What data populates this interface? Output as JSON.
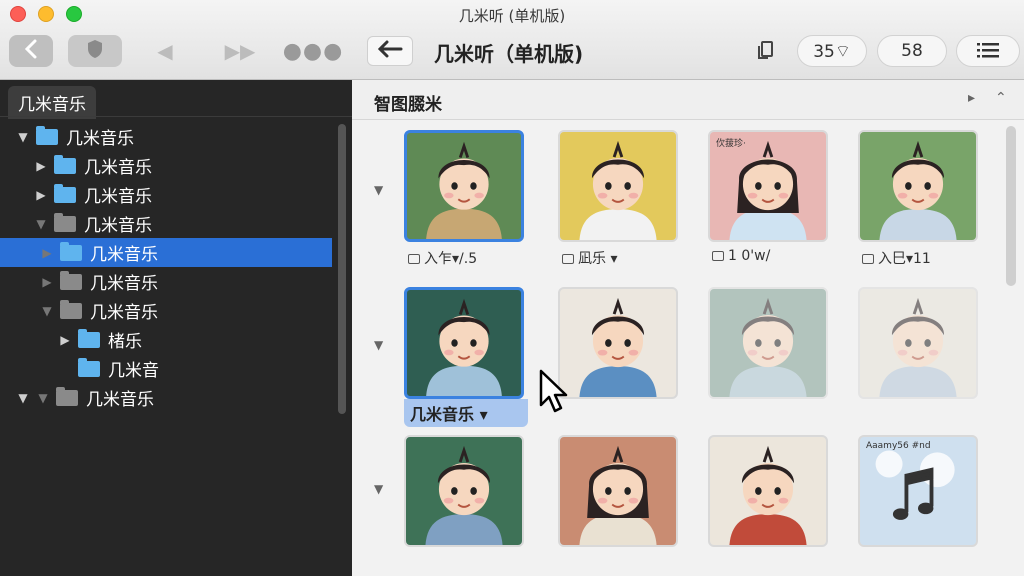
{
  "window": {
    "title": "几米听 (单机版)"
  },
  "toolbar": {
    "main_title": "几米听（单机版)",
    "pill_left": "35⌔",
    "pill_right": "58"
  },
  "sidebar": {
    "tab_label": "几米音乐",
    "items": [
      {
        "label": "几米音乐",
        "depth": 0,
        "state": "expanded",
        "color": "blue",
        "selected": false
      },
      {
        "label": "几米音乐",
        "depth": 1,
        "state": "collapsed",
        "color": "blue",
        "selected": false
      },
      {
        "label": "几米音乐",
        "depth": 1,
        "state": "collapsed",
        "color": "blue",
        "selected": false
      },
      {
        "label": "几米音乐",
        "depth": 1,
        "state": "expanded-dim",
        "color": "gray",
        "selected": false
      },
      {
        "label": "几米音乐",
        "depth": 2,
        "state": "collapsed-dim",
        "color": "blue",
        "selected": true
      },
      {
        "label": "几米音乐",
        "depth": 2,
        "state": "collapsed-dim",
        "color": "gray",
        "selected": false
      },
      {
        "label": "几米音乐",
        "depth": 2,
        "state": "expanded-dim",
        "color": "gray",
        "selected": false
      },
      {
        "label": "楮乐",
        "depth": 3,
        "state": "collapsed",
        "color": "blue",
        "selected": false
      },
      {
        "label": "几米音",
        "depth": 3,
        "state": "none",
        "color": "blue",
        "selected": false
      },
      {
        "label": "几米音乐",
        "depth": 0,
        "state": "expanded-dim2",
        "color": "gray",
        "selected": false
      }
    ]
  },
  "content": {
    "section_title": "智图腏米",
    "tiles": [
      {
        "caption": "入乍▾/.5",
        "row": 0,
        "col": 0,
        "selected": true,
        "bg": "#5f8a55",
        "art_text": ""
      },
      {
        "caption": "凪乐 ▾",
        "row": 0,
        "col": 1,
        "selected": false,
        "bg": "#e3c95c",
        "art_text": ""
      },
      {
        "caption": "1 0'w/",
        "row": 0,
        "col": 2,
        "selected": false,
        "bg": "#e8b7b4",
        "art_text": "㐸菝珍·"
      },
      {
        "caption": "入巳▾11",
        "row": 0,
        "col": 3,
        "selected": false,
        "bg": "#79a469",
        "art_text": ""
      },
      {
        "caption": "几米音乐 ▾",
        "row": 1,
        "col": 0,
        "selected": true,
        "bg": "#2f5e52",
        "art_text": ""
      },
      {
        "caption": "",
        "row": 1,
        "col": 1,
        "selected": false,
        "bg": "#ece7df",
        "art_text": ""
      },
      {
        "caption": "",
        "row": 1,
        "col": 2,
        "selected": false,
        "bg": "#7f9f92",
        "art_text": "",
        "faded": true
      },
      {
        "caption": "",
        "row": 1,
        "col": 3,
        "selected": false,
        "bg": "#e6e2d8",
        "art_text": "",
        "faded": true
      },
      {
        "caption": "",
        "row": 2,
        "col": 0,
        "selected": false,
        "bg": "#3e7257",
        "art_text": ""
      },
      {
        "caption": "",
        "row": 2,
        "col": 1,
        "selected": false,
        "bg": "#c98c72",
        "art_text": ""
      },
      {
        "caption": "",
        "row": 2,
        "col": 2,
        "selected": false,
        "bg": "#ece6dc",
        "art_text": ""
      },
      {
        "caption": "",
        "row": 2,
        "col": 3,
        "selected": false,
        "bg": "#cfe0ef",
        "art_text": "Aaamy56 #nd"
      }
    ]
  },
  "colors": {
    "selection_blue": "#2a6fd6",
    "sidebar_bg": "#262626",
    "folder_blue": "#5fb4ee"
  }
}
